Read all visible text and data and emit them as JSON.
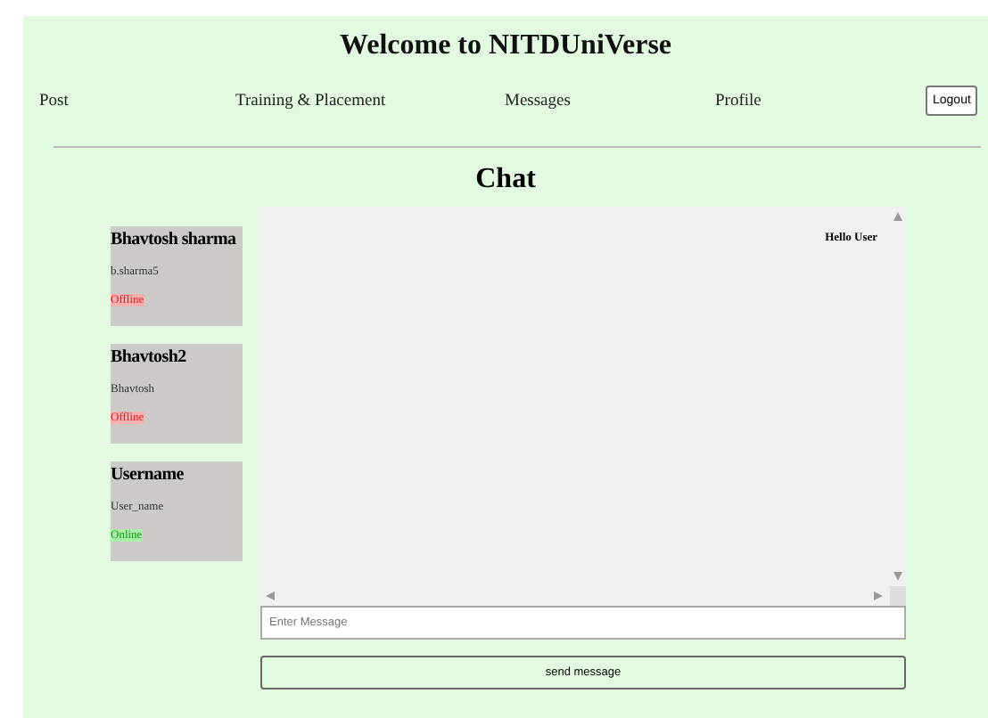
{
  "title": "Welcome to NITDUniVerse",
  "nav": [
    {
      "label": "Post"
    },
    {
      "label": "Training & Placement"
    },
    {
      "label": "Messages"
    },
    {
      "label": "Profile"
    }
  ],
  "logout": "Logout",
  "chat": {
    "heading": "Chat",
    "contacts": [
      {
        "name": "Bhavtosh sharma",
        "username": "b.sharma5",
        "status": "Offline",
        "online": false
      },
      {
        "name": "Bhavtosh2",
        "username": "Bhavtosh",
        "status": "Offline",
        "online": false
      },
      {
        "name": "Username",
        "username": "User_name",
        "status": "Online",
        "online": true
      }
    ],
    "messages": [
      {
        "text": "Hello User"
      }
    ],
    "input": {
      "placeholder": "Enter Message"
    },
    "send": "send message"
  }
}
